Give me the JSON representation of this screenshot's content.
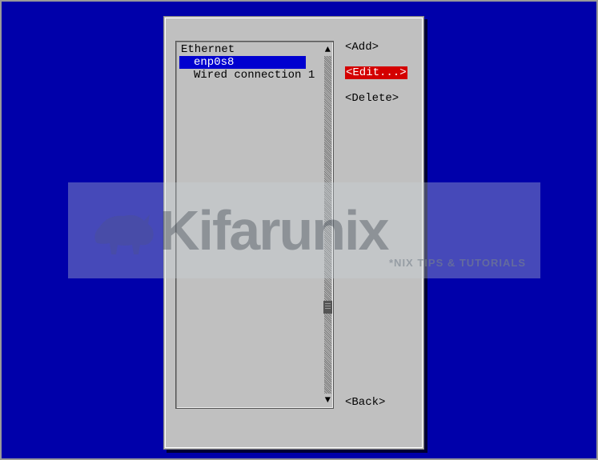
{
  "listbox": {
    "header": "Ethernet",
    "items": [
      {
        "label": "enp0s8",
        "selected": true
      },
      {
        "label": "Wired connection 1",
        "selected": false
      }
    ]
  },
  "buttons": {
    "add": "<Add>",
    "edit": "<Edit...>",
    "delete": "<Delete>",
    "back": "<Back>"
  },
  "watermark": {
    "main": "Kifarunix",
    "sub": "*NIX TIPS & TUTORIALS"
  }
}
